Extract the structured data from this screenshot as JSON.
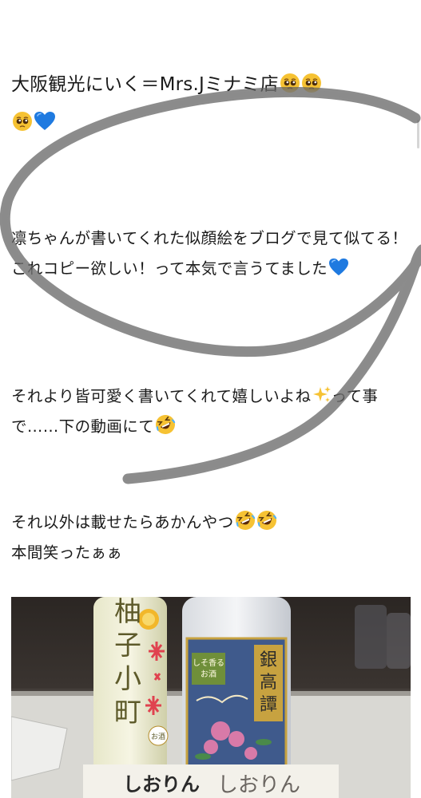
{
  "post": {
    "title": "大阪観光にいく＝Mrs.Jミナミ店",
    "title_emojis": [
      "pleading-face",
      "pleading-face",
      "pleading-face",
      "blue-heart"
    ],
    "paragraphs": [
      {
        "text": "凛ちゃんが書いてくれた似顔絵をブログで見て似てる！これコピー欲しい！って本気で言うてました",
        "trailing_emoji": "blue-heart"
      },
      {
        "text_before": "それより皆可愛く書いてくれて嬉しいよね",
        "mid_emoji": "sparkles",
        "text_after": "って事で……下の動画にて",
        "trailing_emoji": "rolling-on-floor-laughing"
      },
      {
        "line1": "それ以外は載せたらあかんやつ",
        "line1_emojis": [
          "rolling-on-floor-laughing",
          "rolling-on-floor-laughing"
        ],
        "line2": "本間笑ったぁぁ"
      }
    ]
  },
  "photo": {
    "bottle_left_label": "柚子小町",
    "bottle_left_small": "お酒",
    "bottle_right_label": "銀高譚",
    "bottle_right_tag": "しそ香るお酒",
    "sign_text": "しおりん",
    "sign_text_hand": "しおりん"
  },
  "colors": {
    "text": "#1a1a1a",
    "scribble": "#5f5f5f",
    "blue_heart": "#1f7ae0",
    "emoji_yellow": "#f6c233"
  }
}
